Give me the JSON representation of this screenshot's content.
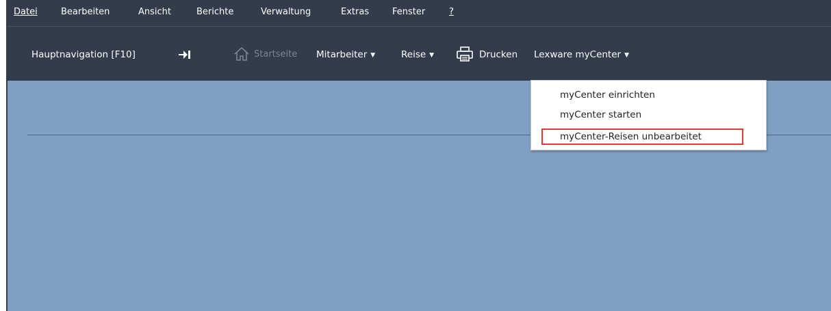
{
  "menubar": {
    "items": [
      {
        "label": "Datei"
      },
      {
        "label": "Bearbeiten"
      },
      {
        "label": "Ansicht"
      },
      {
        "label": "Berichte"
      },
      {
        "label": "Verwaltung"
      },
      {
        "label": "Extras"
      },
      {
        "label": "Fenster"
      },
      {
        "label": "?"
      }
    ]
  },
  "toolbar": {
    "main_nav_label": "Hauptnavigation [F10]",
    "pin_icon": "pin-icon",
    "home_icon": "home-icon",
    "startseite_label": "Startseite",
    "mitarbeiter_label": "Mitarbeiter",
    "reise_label": "Reise",
    "printer_icon": "printer-icon",
    "drucken_label": "Drucken",
    "mycenter_label": "Lexware myCenter"
  },
  "dropdown": {
    "items": [
      {
        "label": "myCenter einrichten"
      },
      {
        "label": "myCenter starten"
      },
      {
        "label": "myCenter-Reisen unbearbeitet"
      }
    ],
    "highlight_color": "#e53935"
  },
  "colors": {
    "chrome": "#323c4b",
    "workspace": "#7f9fc3",
    "disabled_text": "#7a8596"
  }
}
